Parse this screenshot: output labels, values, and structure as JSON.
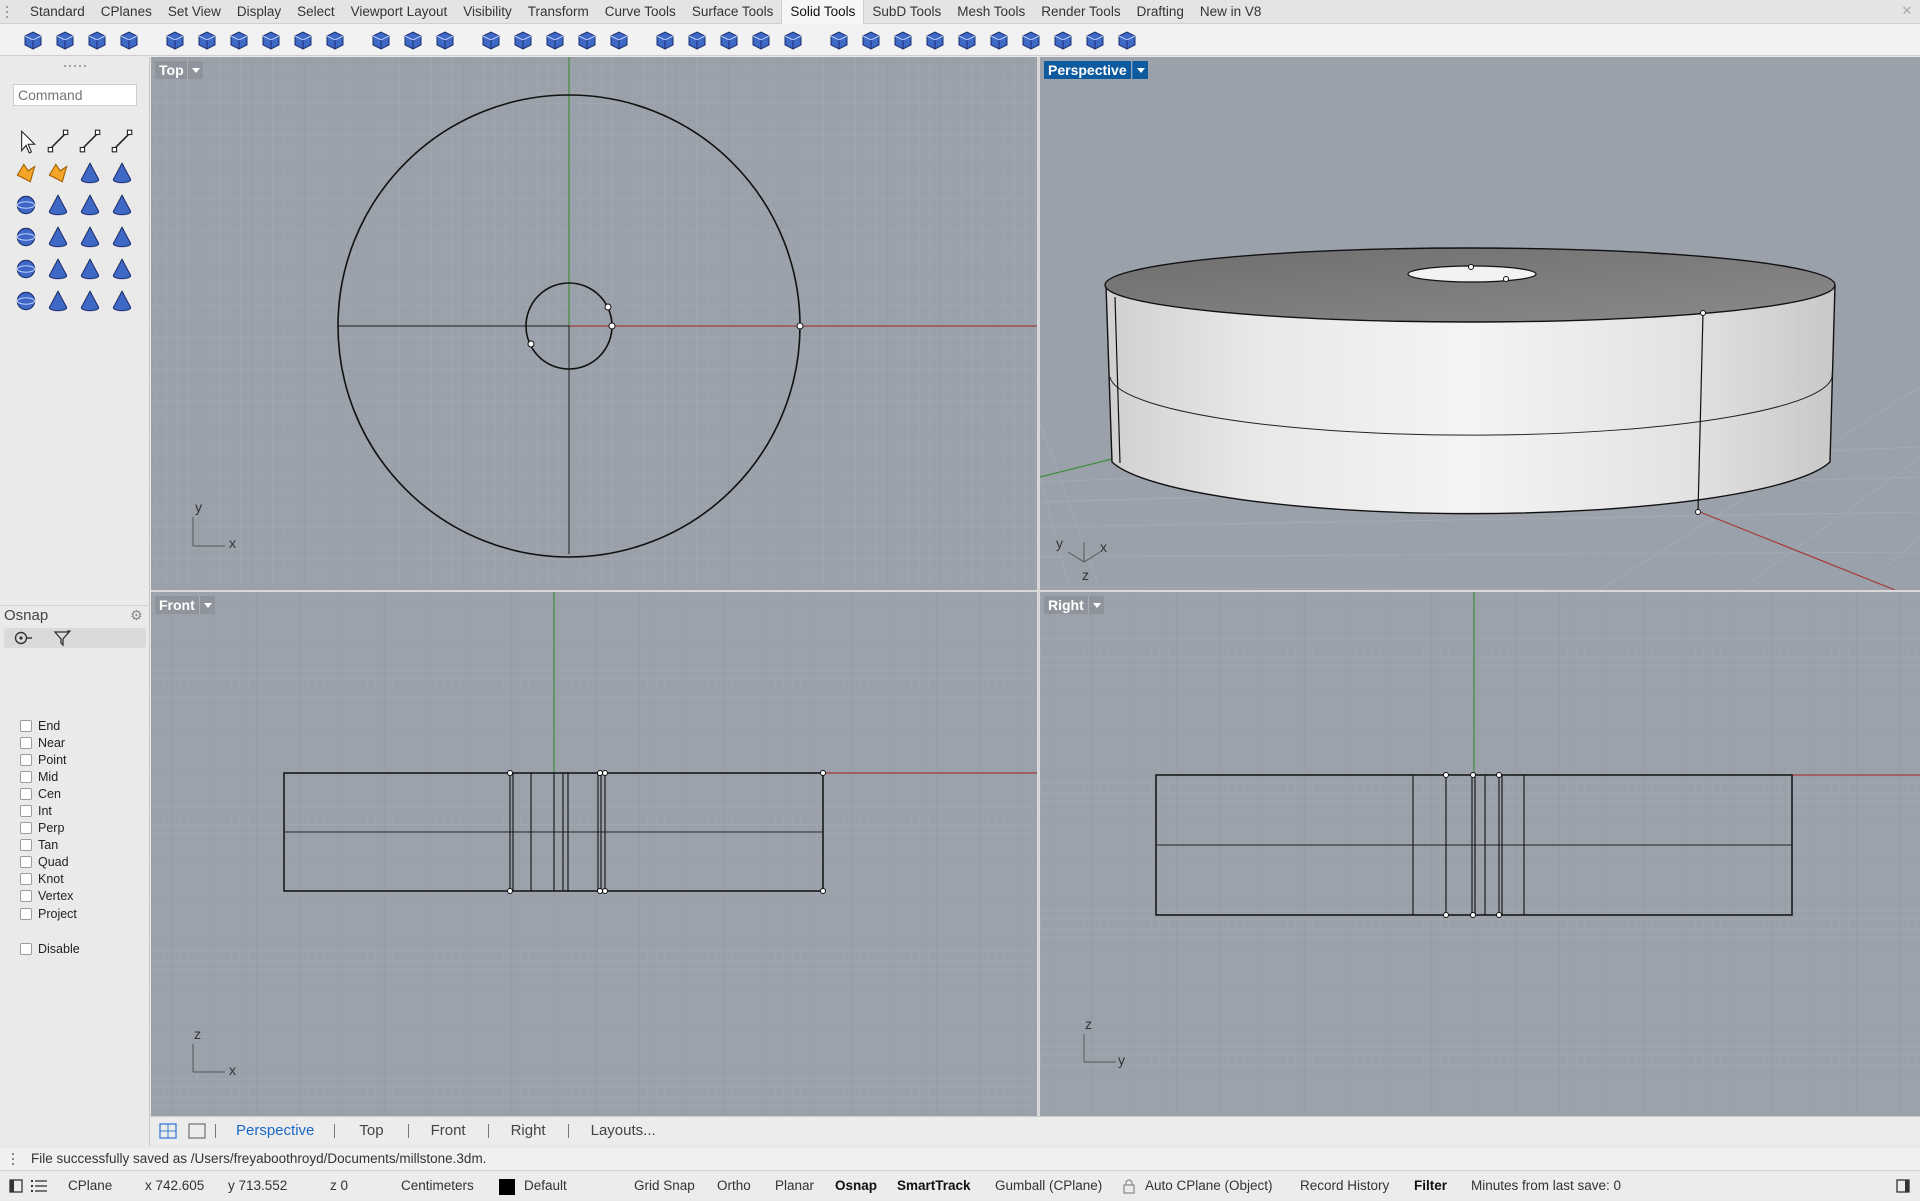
{
  "tabs": [
    "Standard",
    "CPlanes",
    "Set View",
    "Display",
    "Select",
    "Viewport Layout",
    "Visibility",
    "Transform",
    "Curve Tools",
    "Surface Tools",
    "Solid Tools",
    "SubD Tools",
    "Mesh Tools",
    "Render Tools",
    "Drafting",
    "New in V8"
  ],
  "active_tab": "Solid Tools",
  "command_placeholder": "Command",
  "osnap": {
    "title": "Osnap",
    "items": [
      "End",
      "Near",
      "Point",
      "Mid",
      "Cen",
      "Int",
      "Perp",
      "Tan",
      "Quad",
      "Knot",
      "Vertex",
      "Project"
    ],
    "disable_label": "Disable"
  },
  "viewports": {
    "top": {
      "label": "Top",
      "axis_h": "x",
      "axis_v": "y"
    },
    "perspective": {
      "label": "Perspective",
      "axis_x": "x",
      "axis_y": "y",
      "axis_z": "z"
    },
    "front": {
      "label": "Front",
      "axis_h": "x",
      "axis_v": "z"
    },
    "right": {
      "label": "Right",
      "axis_h": "y",
      "axis_v": "z"
    }
  },
  "viewport_tabs": [
    "Perspective",
    "Top",
    "Front",
    "Right",
    "Layouts..."
  ],
  "active_viewport_tab": "Perspective",
  "status_message": "File successfully saved as /Users/freyaboothroyd/Documents/millstone.3dm.",
  "statusbar": {
    "cplane": "CPlane",
    "x": "x 742.605",
    "y": "y 713.552",
    "z": "z 0",
    "units": "Centimeters",
    "layer": "Default",
    "layer_color": "#000000",
    "grid_snap": "Grid Snap",
    "ortho": "Ortho",
    "planar": "Planar",
    "osnap": "Osnap",
    "smarttrack": "SmartTrack",
    "gumball": "Gumball (CPlane)",
    "auto_cplane": "Auto CPlane (Object)",
    "record_history": "Record History",
    "filter": "Filter",
    "minutes": "Minutes from last save: 0"
  },
  "colors": {
    "viewport_bg": "#9aa0a9",
    "grid_minor": "#a5abb3",
    "grid_major": "#8c929a",
    "active_label": "#0e5a9e",
    "x_axis": "#a33a3a",
    "y_axis": "#3f8e3f"
  }
}
